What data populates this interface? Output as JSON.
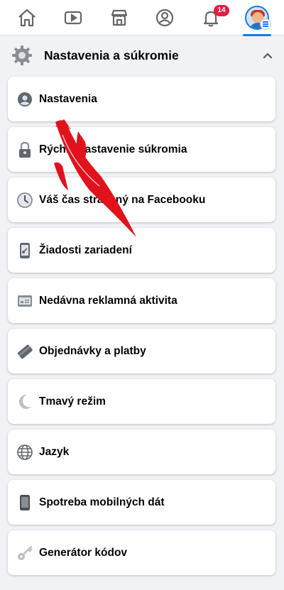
{
  "nav": {
    "items": [
      {
        "icon": "home-icon"
      },
      {
        "icon": "watch-icon"
      },
      {
        "icon": "marketplace-icon"
      },
      {
        "icon": "profile-icon"
      },
      {
        "icon": "bell-icon",
        "badge": "14"
      },
      {
        "icon": "avatar-menu-icon"
      }
    ],
    "notification_badge": "14",
    "active_color": "#1877f2",
    "badge_color": "#e41e3f"
  },
  "section": {
    "title": "Nastavenia a súkromie",
    "icon": "gear-icon"
  },
  "menu": [
    {
      "label": "Nastavenia",
      "icon": "person-circle-icon"
    },
    {
      "label": "Rýchle nastavenie súkromia",
      "icon": "lock-icon"
    },
    {
      "label": "Váš čas strávený na Facebooku",
      "icon": "clock-icon"
    },
    {
      "label": "Žiadosti zariadení",
      "icon": "phone-key-icon"
    },
    {
      "label": "Nedávna reklamná aktivita",
      "icon": "ad-activity-icon"
    },
    {
      "label": "Objednávky a platby",
      "icon": "card-icon"
    },
    {
      "label": "Tmavý režim",
      "icon": "moon-icon"
    },
    {
      "label": "Jazyk",
      "icon": "globe-icon"
    },
    {
      "label": "Spotreba mobilných dát",
      "icon": "mobile-icon"
    },
    {
      "label": "Generátor kódov",
      "icon": "key-icon"
    }
  ],
  "annotation": {
    "arrow_color": "#e0121c"
  }
}
